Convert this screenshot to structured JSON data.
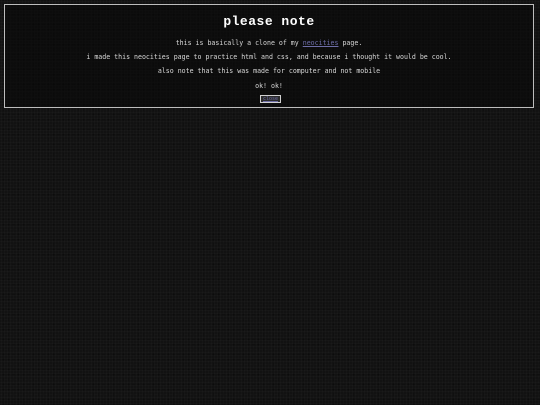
{
  "notice": {
    "title": "please note",
    "line1_before": "this is basically a clone of my ",
    "line1_link": "neocities",
    "line1_after": " page.",
    "line2": "i made this neocities page to practice html and css, and because i thought it would be cool.",
    "line3": "also note that this was made for computer and not mobile",
    "line4": "ok! ok!",
    "button_label": "close"
  },
  "colors": {
    "background": "#121212",
    "border": "#bdbdbd",
    "link": "#6e6ea8",
    "text": "#d8d8d8"
  }
}
